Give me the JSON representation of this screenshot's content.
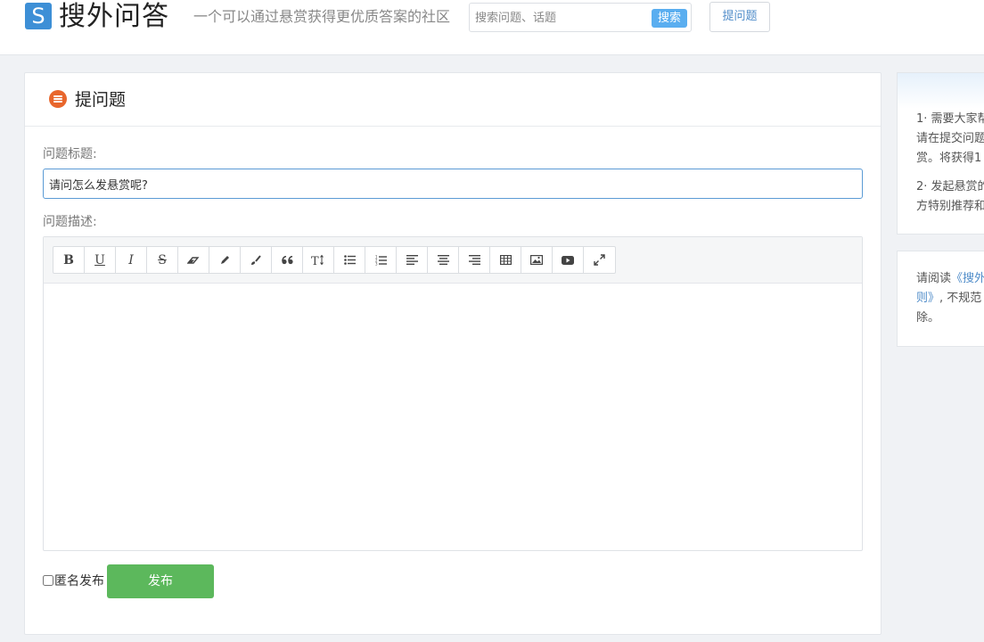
{
  "header": {
    "logo_letter": "S",
    "site_name": "搜外问答",
    "tagline": "一个可以通过悬赏获得更优质答案的社区",
    "search_placeholder": "搜索问题、话题",
    "search_button": "搜索",
    "ask_button": "提问题"
  },
  "main": {
    "title": "提问题",
    "title_label": "问题标题:",
    "title_value": "请问怎么发悬赏呢?",
    "desc_label": "问题描述:",
    "toolbar": [
      {
        "name": "bold",
        "glyph": "B"
      },
      {
        "name": "underline",
        "glyph": "U"
      },
      {
        "name": "italic",
        "glyph": "I"
      },
      {
        "name": "strikethrough",
        "glyph": "S"
      },
      {
        "name": "eraser",
        "glyph": ""
      },
      {
        "name": "pencil",
        "glyph": ""
      },
      {
        "name": "brush",
        "glyph": ""
      },
      {
        "name": "quote",
        "glyph": "66"
      },
      {
        "name": "text-size",
        "glyph": "TI"
      },
      {
        "name": "unordered-list",
        "glyph": ""
      },
      {
        "name": "ordered-list",
        "glyph": ""
      },
      {
        "name": "align-left",
        "glyph": ""
      },
      {
        "name": "align-center",
        "glyph": ""
      },
      {
        "name": "align-right",
        "glyph": ""
      },
      {
        "name": "table",
        "glyph": ""
      },
      {
        "name": "image",
        "glyph": ""
      },
      {
        "name": "video",
        "glyph": ""
      },
      {
        "name": "fullscreen",
        "glyph": ""
      }
    ],
    "anonymous_label": "匿名发布",
    "publish_button": "发布"
  },
  "sidebar": {
    "tips": {
      "line1": "1· 需要大家帮",
      "line2": "请在提交问题",
      "line3": "赏。将获得1",
      "line4": "2· 发起悬赏的",
      "line5": "方特别推荐和"
    },
    "rules": {
      "prefix": "请阅读",
      "link_part1": "《搜外",
      "link_part2": "则》",
      "suffix": ", 不规范",
      "line3": "除。"
    }
  }
}
